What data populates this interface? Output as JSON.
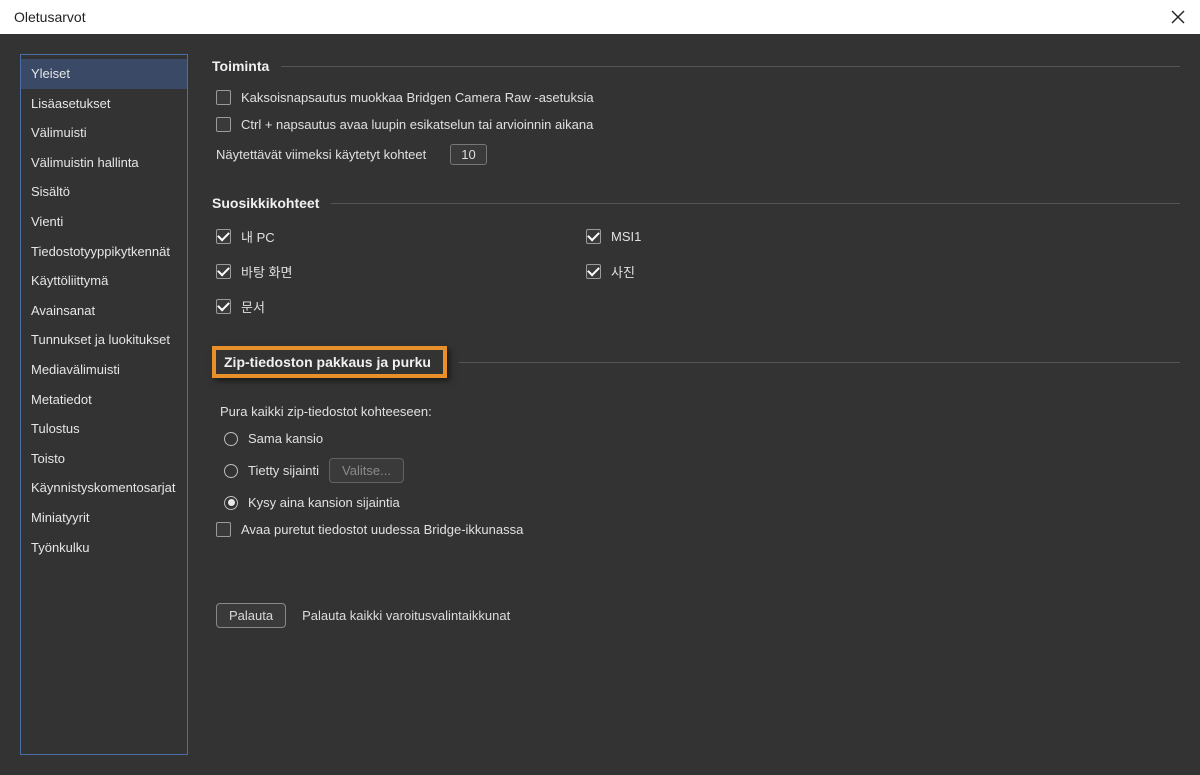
{
  "window": {
    "title": "Oletusarvot"
  },
  "sidebar": {
    "items": [
      "Yleiset",
      "Lisäasetukset",
      "Välimuisti",
      "Välimuistin hallinta",
      "Sisältö",
      "Vienti",
      "Tiedostotyyppikytkennät",
      "Käyttöliittymä",
      "Avainsanat",
      "Tunnukset ja luokitukset",
      "Mediavälimuisti",
      "Metatiedot",
      "Tulostus",
      "Toisto",
      "Käynnistyskomentosarjat",
      "Miniatyyrit",
      "Työnkulku"
    ],
    "activeIndex": 0
  },
  "behavior": {
    "title": "Toiminta",
    "doubleClick": "Kaksoisnapsautus muokkaa Bridgen Camera Raw -asetuksia",
    "ctrlClick": "Ctrl + napsautus avaa luupin esikatselun tai arvioinnin aikana",
    "recentItemsLabel": "Näytettävät viimeksi käytetyt kohteet",
    "recentItemsValue": "10"
  },
  "favorites": {
    "title": "Suosikkikohteet",
    "items": [
      {
        "label": "내 PC",
        "checked": true
      },
      {
        "label": "MSI1",
        "checked": true
      },
      {
        "label": "바탕 화면",
        "checked": true
      },
      {
        "label": "사진",
        "checked": true
      },
      {
        "label": "문서",
        "checked": true
      }
    ]
  },
  "zip": {
    "title": "Zip-tiedoston pakkaus ja purku",
    "extractLabel": "Pura kaikki zip-tiedostot kohteeseen:",
    "options": {
      "same": "Sama kansio",
      "specific": "Tietty sijainti",
      "ask": "Kysy aina kansion sijaintia"
    },
    "selected": "ask",
    "chooseBtn": "Valitse...",
    "openExtracted": "Avaa puretut tiedostot uudessa Bridge-ikkunassa"
  },
  "footer": {
    "resetBtn": "Palauta",
    "resetLabel": "Palauta kaikki varoitusvalintaikkunat"
  }
}
